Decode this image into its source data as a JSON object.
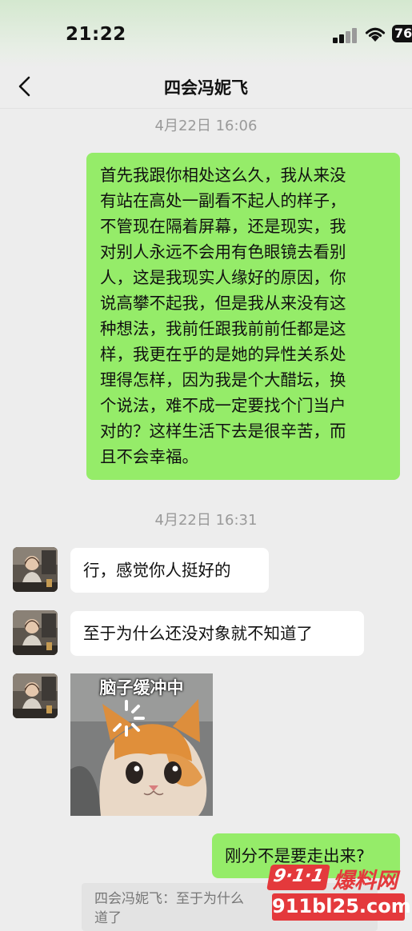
{
  "status_bar": {
    "time": "21:22",
    "battery": "76"
  },
  "header": {
    "title": "四会冯妮飞"
  },
  "messages": [
    {
      "type": "timestamp",
      "text": "4月22日 16:06"
    },
    {
      "type": "outgoing",
      "lines": [
        "首先我跟你相处这么久，我从来没",
        "有站在高处一副看不起人的样子，",
        "不管现在隔着屏幕，还是现实，我",
        "对别人永远不会用有色眼镜去看别",
        "人，这是我现实人缘好的原因，你",
        "说高攀不起我，但是我从来没有这",
        "种想法，我前任跟我前前任都是这",
        "样，我更在乎的是她的异性关系处",
        "理得怎样，因为我是个大醋坛，换",
        "个说法，难不成一定要找个门当户",
        "对的？这样生活下去是很辛苦，而",
        "且不会幸福。"
      ]
    },
    {
      "type": "timestamp",
      "text": "4月22日 16:31"
    },
    {
      "type": "incoming",
      "text": "行，感觉你人挺好的"
    },
    {
      "type": "incoming",
      "text": "至于为什么还没对象就不知道了"
    },
    {
      "type": "incoming_sticker",
      "caption": "脑子缓冲中"
    },
    {
      "type": "outgoing",
      "text": "刚分不是要走出来?"
    }
  ],
  "quote": {
    "line1": "四会冯妮飞：至于为什么",
    "line2": "道了"
  },
  "watermark": {
    "badge": "9·1·1",
    "brand": "爆料网",
    "url": "911bl25.com"
  },
  "colors": {
    "outgoing_bubble": "#95ec69",
    "incoming_bubble": "#ffffff",
    "background": "#ededed",
    "watermark_red": "#e4393c"
  }
}
